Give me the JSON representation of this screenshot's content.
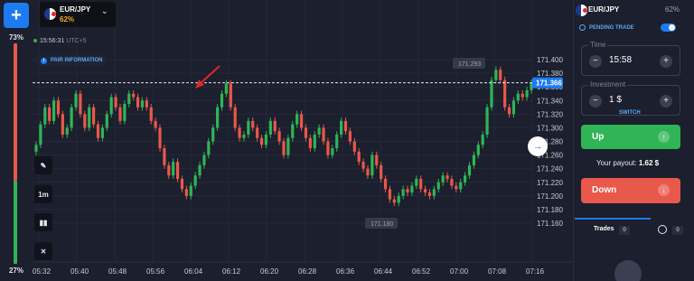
{
  "left_rail": {
    "add_label": "+",
    "up_pct": "73%",
    "down_pct": "27%"
  },
  "pair_selector": {
    "name": "EUR/JPY",
    "payout_pct": "62%",
    "chevron_glyph": "⌄"
  },
  "chart": {
    "clock_time": "15:56:31",
    "clock_tz": "UTC+5",
    "pair_info_label": "PAIR INFORMATION",
    "price_labels": [
      "171.400",
      "171.380",
      "171.360",
      "171.340",
      "171.320",
      "171.300",
      "171.280",
      "171.260",
      "171.240",
      "171.220",
      "171.200",
      "171.180",
      "171.160"
    ],
    "current_price": "171.366",
    "high_marker": "171.293",
    "low_marker": "171.180",
    "time_labels": [
      "05:32",
      "05:40",
      "05:48",
      "05:56",
      "06:04",
      "06:12",
      "06:20",
      "06:28",
      "06:36",
      "06:44",
      "06:52",
      "07:00",
      "07:08",
      "07:16"
    ],
    "tools": {
      "draw": "✎",
      "timeframe": "1m",
      "chart_type": "▮▮",
      "indicators": "✕"
    },
    "scroll_glyph": "→",
    "colors": {
      "bull": "#2fb556",
      "bear": "#e8584b",
      "accent": "#1d7bf2",
      "marker": "#e02828"
    }
  },
  "panel": {
    "pair": "EUR/JPY",
    "pct": "62%",
    "pending_label": "PENDING TRADE",
    "time": {
      "legend": "Time",
      "value": "15:58",
      "minus": "−",
      "plus": "+"
    },
    "investment": {
      "legend": "Investment",
      "value": "1 $",
      "minus": "−",
      "plus": "+"
    },
    "switch_label": "SWITCH",
    "up_label": "Up",
    "up_icon": "↑",
    "payout_label": "Your payout:",
    "payout_value": "1.62 $",
    "down_label": "Down",
    "down_icon": "↓",
    "trades_label": "Trades",
    "trades_count": "0",
    "history_count": "0"
  }
}
